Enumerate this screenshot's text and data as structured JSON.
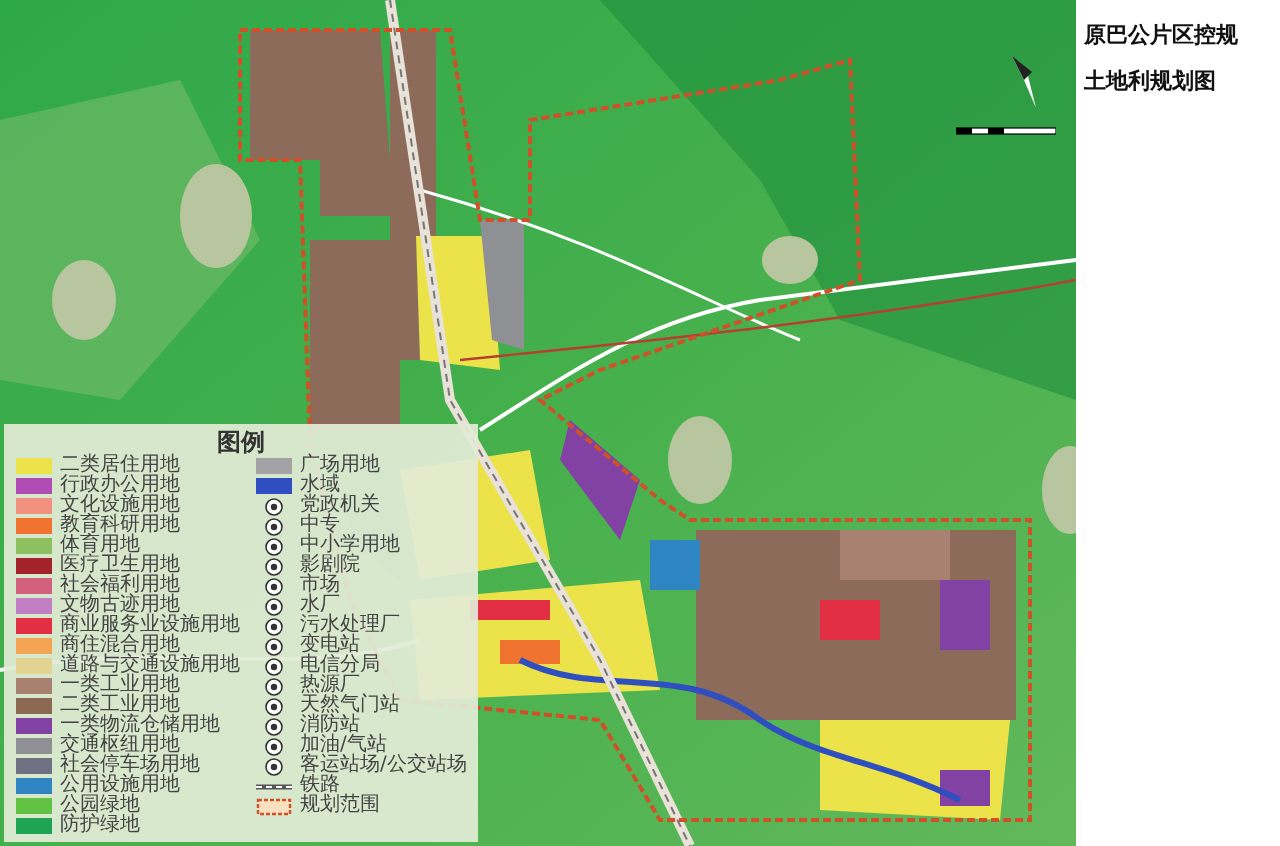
{
  "title_lines": [
    "原巴公片区控规",
    "土地利规划图"
  ],
  "legend": {
    "title": "图例",
    "columns": [
      [
        {
          "kind": "swatch",
          "label": "二类居住用地",
          "color": "#ece34a"
        },
        {
          "kind": "swatch",
          "label": "行政办公用地",
          "color": "#b04cb4"
        },
        {
          "kind": "swatch",
          "label": "文化设施用地",
          "color": "#f2917e"
        },
        {
          "kind": "swatch",
          "label": "教育科研用地",
          "color": "#f07430"
        },
        {
          "kind": "swatch",
          "label": "体育用地",
          "color": "#8fc060"
        },
        {
          "kind": "swatch",
          "label": "医疗卫生用地",
          "color": "#a3232b"
        },
        {
          "kind": "swatch",
          "label": "社会福利用地",
          "color": "#d3607f"
        },
        {
          "kind": "swatch",
          "label": "文物古迹用地",
          "color": "#c27fc4"
        },
        {
          "kind": "swatch",
          "label": "商业服务业设施用地",
          "color": "#e32f43"
        },
        {
          "kind": "swatch",
          "label": "商住混合用地",
          "color": "#f3a454"
        },
        {
          "kind": "swatch",
          "label": "道路与交通设施用地",
          "color": "#e3d392"
        },
        {
          "kind": "swatch",
          "label": "一类工业用地",
          "color": "#a88170"
        },
        {
          "kind": "swatch",
          "label": "二类工业用地",
          "color": "#8c6a52"
        },
        {
          "kind": "swatch",
          "label": "一类物流仓储用地",
          "color": "#8142a3"
        },
        {
          "kind": "swatch",
          "label": "交通枢纽用地",
          "color": "#8f9093"
        },
        {
          "kind": "swatch",
          "label": "社会停车场用地",
          "color": "#6f7183"
        },
        {
          "kind": "swatch",
          "label": "公用设施用地",
          "color": "#2f84c2"
        },
        {
          "kind": "swatch",
          "label": "公园绿地",
          "color": "#62c243"
        },
        {
          "kind": "swatch",
          "label": "防护绿地",
          "color": "#1fa454"
        }
      ],
      [
        {
          "kind": "swatch",
          "label": "广场用地",
          "color": "#a3a3a6"
        },
        {
          "kind": "swatch",
          "label": "水域",
          "color": "#2f4fc0"
        },
        {
          "kind": "symbol",
          "label": "党政机关"
        },
        {
          "kind": "symbol",
          "label": "中专"
        },
        {
          "kind": "symbol",
          "label": "中小学用地"
        },
        {
          "kind": "symbol",
          "label": "影剧院"
        },
        {
          "kind": "symbol",
          "label": "市场"
        },
        {
          "kind": "symbol",
          "label": "水厂"
        },
        {
          "kind": "symbol",
          "label": "污水处理厂"
        },
        {
          "kind": "symbol",
          "label": "变电站"
        },
        {
          "kind": "symbol",
          "label": "电信分局"
        },
        {
          "kind": "symbol",
          "label": "热源厂"
        },
        {
          "kind": "symbol",
          "label": "天然气门站"
        },
        {
          "kind": "symbol",
          "label": "消防站"
        },
        {
          "kind": "symbol",
          "label": "加油/气站"
        },
        {
          "kind": "symbol",
          "label": "客运站场/公交站场"
        },
        {
          "kind": "line",
          "label": "铁路"
        },
        {
          "kind": "boundary",
          "label": "规划范围"
        }
      ]
    ]
  }
}
